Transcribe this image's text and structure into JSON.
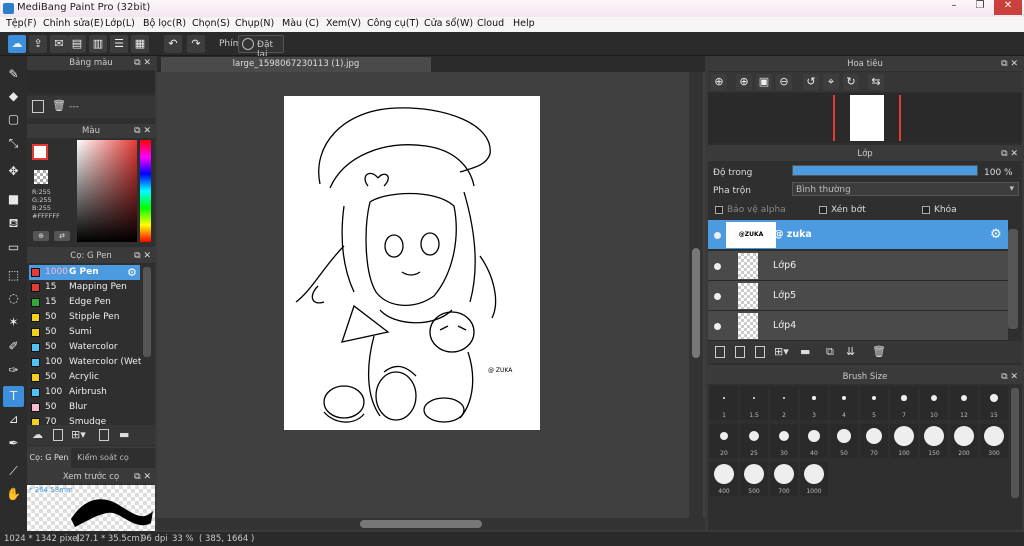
{
  "window": {
    "title": "MediBang Paint Pro (32bit)",
    "minimize": "–",
    "maximize": "❐",
    "close": "✕"
  },
  "menu": [
    "Tệp(F)",
    "Chỉnh sửa(E)",
    "Lớp(L)",
    "Bộ lọc(R)",
    "Chọn(S)",
    "Chụp(N)",
    "Màu (C)",
    "Xem(V)",
    "Công cụ(T)",
    "Cửa sổ(W)",
    "Cloud",
    "Help"
  ],
  "toolbar": {
    "phim_label": "Phím",
    "reset_label": "Đặt lại"
  },
  "canvas": {
    "tab_name": "large_1598067230113 (1).jpg",
    "watermark": "@ ZUKA"
  },
  "palette_panel": {
    "title": "Bảng màu",
    "value": "---"
  },
  "color_panel": {
    "title": "Màu",
    "r": "R:255",
    "g": "G:255",
    "b": "B:255",
    "hex": "#FFFFFF"
  },
  "brush_panel": {
    "title": "Cọ: G Pen",
    "items": [
      {
        "size": "1000",
        "name": "G Pen",
        "color": "#e53935"
      },
      {
        "size": "15",
        "name": "Mapping Pen",
        "color": "#e53935"
      },
      {
        "size": "15",
        "name": "Edge Pen",
        "color": "#2ea836"
      },
      {
        "size": "50",
        "name": "Stipple Pen",
        "color": "#f2d01c"
      },
      {
        "size": "50",
        "name": "Sumi",
        "color": "#f2d01c"
      },
      {
        "size": "50",
        "name": "Watercolor",
        "color": "#4fc3f7"
      },
      {
        "size": "100",
        "name": "Watercolor (Wet)",
        "color": "#4fc3f7"
      },
      {
        "size": "50",
        "name": "Acrylic",
        "color": "#f2d01c"
      },
      {
        "size": "100",
        "name": "Airbrush",
        "color": "#4fc3f7"
      },
      {
        "size": "50",
        "name": "Blur",
        "color": "#f8bbd0"
      },
      {
        "size": "70",
        "name": "Smudge",
        "color": "#f2d01c"
      }
    ]
  },
  "brush_tabs": {
    "tab1": "Cọ: G Pen",
    "tab2": "Kiểm soát cọ"
  },
  "preview_panel": {
    "title": "Xem trước cọ",
    "size": "* 264.58mm"
  },
  "navigator": {
    "title": "Hoa tiêu"
  },
  "layer_panel": {
    "title": "Lớp",
    "opacity_label": "Độ trong",
    "opacity_value": "100 %",
    "opacity_fraction": 1.0,
    "blend_label": "Pha trộn",
    "blend_value": "Bình thường",
    "protect_alpha": "Bảo vệ alpha",
    "clipping": "Xén bớt",
    "lock": "Khóa",
    "layers": [
      {
        "name": "@ zuka",
        "thumb": "@ZUKA"
      },
      {
        "name": "Lớp6"
      },
      {
        "name": "Lớp5"
      },
      {
        "name": "Lớp4"
      }
    ]
  },
  "brush_size_panel": {
    "title": "Brush Size",
    "sizes": [
      "1",
      "1.5",
      "2",
      "3",
      "4",
      "5",
      "7",
      "10",
      "12",
      "15",
      "20",
      "25",
      "30",
      "40",
      "50",
      "70",
      "100",
      "150",
      "200",
      "300",
      "400",
      "500",
      "700",
      "1000"
    ]
  },
  "status": {
    "image_size": "1024 * 1342 pixel",
    "physical": "(27.1 * 35.5cm)",
    "dpi": "96 dpi",
    "zoom": "33 %",
    "coords": "( 385, 1664 )"
  },
  "colors": {
    "accent": "#3c8fdc",
    "selection": "#4c9be0",
    "foreground": "#e53935",
    "background": "#ffffff"
  }
}
